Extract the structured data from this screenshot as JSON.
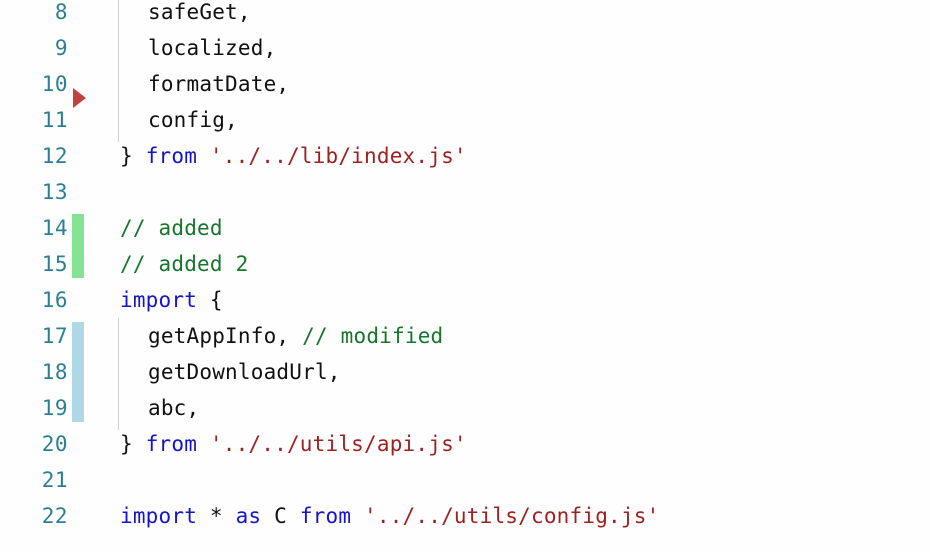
{
  "editor": {
    "kind": "code-editor-diff-gutter",
    "first_visible_line": 8,
    "last_visible_line": 22,
    "line_height_px": 36,
    "colors": {
      "background": "#fefefe",
      "line_number": "#2c7f92",
      "keyword": "#1414cc",
      "string": "#9c2222",
      "comment": "#16762c",
      "plain_text": "#111111",
      "added_bar": "#85e394",
      "modified_bar": "#aed8e6",
      "fold_marker": "#c4413f",
      "indent_guide": "#d0d0d0"
    },
    "gutter": {
      "markers": [
        {
          "name": "fold-change-marker",
          "icon": "triangle-right-icon",
          "at_line": 10,
          "color": "#c4413f"
        }
      ],
      "change_bars": [
        {
          "type": "added",
          "from_line": 14,
          "to_line": 15,
          "color": "#85e394"
        },
        {
          "type": "modified",
          "from_line": 17,
          "to_line": 19,
          "color": "#aed8e6"
        }
      ]
    },
    "indent_guides": [
      {
        "from_line": 8,
        "to_line": 11,
        "depth": 1
      },
      {
        "from_line": 17,
        "to_line": 19,
        "depth": 1
      }
    ],
    "lines": [
      {
        "number": "8",
        "indent": 1,
        "change": "none",
        "text": "safeGet,",
        "tokens": [
          {
            "t": "safeGet,",
            "c": "plain"
          }
        ]
      },
      {
        "number": "9",
        "indent": 1,
        "change": "none",
        "text": "localized,",
        "tokens": [
          {
            "t": "localized,",
            "c": "plain"
          }
        ]
      },
      {
        "number": "10",
        "indent": 1,
        "change": "none",
        "text": "formatDate,",
        "tokens": [
          {
            "t": "formatDate,",
            "c": "plain"
          }
        ]
      },
      {
        "number": "11",
        "indent": 1,
        "change": "none",
        "text": "config,",
        "tokens": [
          {
            "t": "config,",
            "c": "plain"
          }
        ]
      },
      {
        "number": "12",
        "indent": 0,
        "change": "none",
        "text": "} from '../../lib/index.js'",
        "tokens": [
          {
            "t": "} ",
            "c": "punct"
          },
          {
            "t": "from",
            "c": "kw"
          },
          {
            "t": " ",
            "c": "plain"
          },
          {
            "t": "'../../lib/index.js'",
            "c": "str"
          }
        ]
      },
      {
        "number": "13",
        "indent": 0,
        "change": "none",
        "text": "",
        "tokens": []
      },
      {
        "number": "14",
        "indent": 0,
        "change": "added",
        "text": "// added",
        "tokens": [
          {
            "t": "// added",
            "c": "comment"
          }
        ]
      },
      {
        "number": "15",
        "indent": 0,
        "change": "added",
        "text": "// added 2",
        "tokens": [
          {
            "t": "// added 2",
            "c": "comment"
          }
        ]
      },
      {
        "number": "16",
        "indent": 0,
        "change": "none",
        "text": "import {",
        "tokens": [
          {
            "t": "import",
            "c": "kw"
          },
          {
            "t": " {",
            "c": "punct"
          }
        ]
      },
      {
        "number": "17",
        "indent": 1,
        "change": "modified",
        "text": "getAppInfo, // modified",
        "tokens": [
          {
            "t": "getAppInfo, ",
            "c": "plain"
          },
          {
            "t": "// modified",
            "c": "comment"
          }
        ]
      },
      {
        "number": "18",
        "indent": 1,
        "change": "modified",
        "text": "getDownloadUrl,",
        "tokens": [
          {
            "t": "getDownloadUrl,",
            "c": "plain"
          }
        ]
      },
      {
        "number": "19",
        "indent": 1,
        "change": "modified",
        "text": "abc,",
        "tokens": [
          {
            "t": "abc,",
            "c": "plain"
          }
        ]
      },
      {
        "number": "20",
        "indent": 0,
        "change": "none",
        "text": "} from '../../utils/api.js'",
        "tokens": [
          {
            "t": "} ",
            "c": "punct"
          },
          {
            "t": "from",
            "c": "kw"
          },
          {
            "t": " ",
            "c": "plain"
          },
          {
            "t": "'../../utils/api.js'",
            "c": "str"
          }
        ]
      },
      {
        "number": "21",
        "indent": 0,
        "change": "none",
        "text": "",
        "tokens": []
      },
      {
        "number": "22",
        "indent": 0,
        "change": "none",
        "text": "import * as C from '../../utils/config.js'",
        "tokens": [
          {
            "t": "import",
            "c": "kw"
          },
          {
            "t": " * ",
            "c": "punct"
          },
          {
            "t": "as",
            "c": "kw"
          },
          {
            "t": " C ",
            "c": "plain"
          },
          {
            "t": "from",
            "c": "kw"
          },
          {
            "t": " ",
            "c": "plain"
          },
          {
            "t": "'../../utils/config.js'",
            "c": "str"
          }
        ]
      }
    ]
  }
}
